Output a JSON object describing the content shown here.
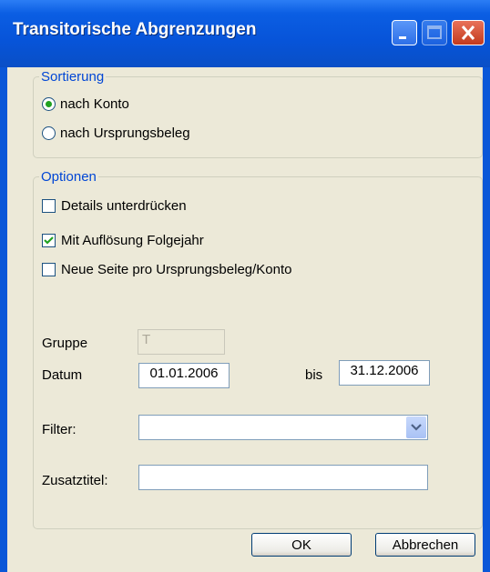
{
  "window": {
    "title": "Transitorische Abgrenzungen"
  },
  "sortierung": {
    "legend": "Sortierung",
    "options": [
      {
        "label": "nach Konto",
        "selected": true
      },
      {
        "label": "nach Ursprungsbeleg",
        "selected": false
      }
    ]
  },
  "optionen": {
    "legend": "Optionen",
    "checks": [
      {
        "label": "Details unterdrücken",
        "checked": false
      },
      {
        "label": "Mit Auflösung Folgejahr",
        "checked": true
      },
      {
        "label": "Neue Seite pro Ursprungsbeleg/Konto",
        "checked": false
      }
    ],
    "gruppe_label": "Gruppe",
    "gruppe_value": "T",
    "datum_label": "Datum",
    "datum_from": "01.01.2006",
    "bis_label": "bis",
    "datum_to": "31.12.2006",
    "filter_label": "Filter:",
    "filter_value": "",
    "zusatztitel_label": "Zusatztitel:",
    "zusatztitel_value": ""
  },
  "buttons": {
    "ok": "OK",
    "cancel": "Abbrechen"
  },
  "colors": {
    "titlebar": "#0a57d8",
    "dialog_bg": "#ece9d8",
    "legend": "#0046d5",
    "check": "#21a121"
  }
}
